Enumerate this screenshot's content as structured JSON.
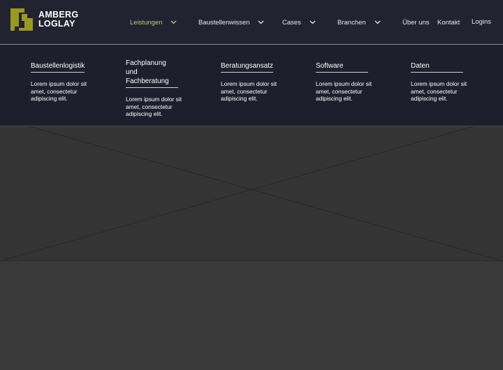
{
  "brand": {
    "line1": "AMBERG",
    "line2": "LOGLAY",
    "accent_color": "#9a9a1e"
  },
  "nav": {
    "items": [
      {
        "label": "Leistungen",
        "dropdown": true,
        "active": true
      },
      {
        "label": "Baustellenwissen",
        "dropdown": true
      },
      {
        "label": "Cases",
        "dropdown": true
      },
      {
        "label": "Branchen",
        "dropdown": true
      },
      {
        "label": "Über uns"
      },
      {
        "label": "Kontakt"
      },
      {
        "label": "Logins"
      }
    ],
    "active_color": "#c3c67a"
  },
  "mega_menu": {
    "columns": [
      {
        "title": "Baustellenlogistik",
        "text": "Lorem ipsum dolor sit amet, consectetur adipiscing elit."
      },
      {
        "title": "Fachplanung und Fachberatung",
        "text": "Lorem ipsum dolor sit amet, consectetur adipiscing elit."
      },
      {
        "title": "Beratungsansatz",
        "text": "Lorem ipsum dolor sit amet, consectetur adipiscing elit."
      },
      {
        "title": "Software",
        "text": "Lorem ipsum dolor sit amet, consectetur adipiscing elit."
      },
      {
        "title": "Daten",
        "text": "Lorem ipsum dolor sit amet, consectetur adipiscing elit."
      }
    ]
  },
  "hero": {
    "icon": "image-placeholder-icon"
  }
}
